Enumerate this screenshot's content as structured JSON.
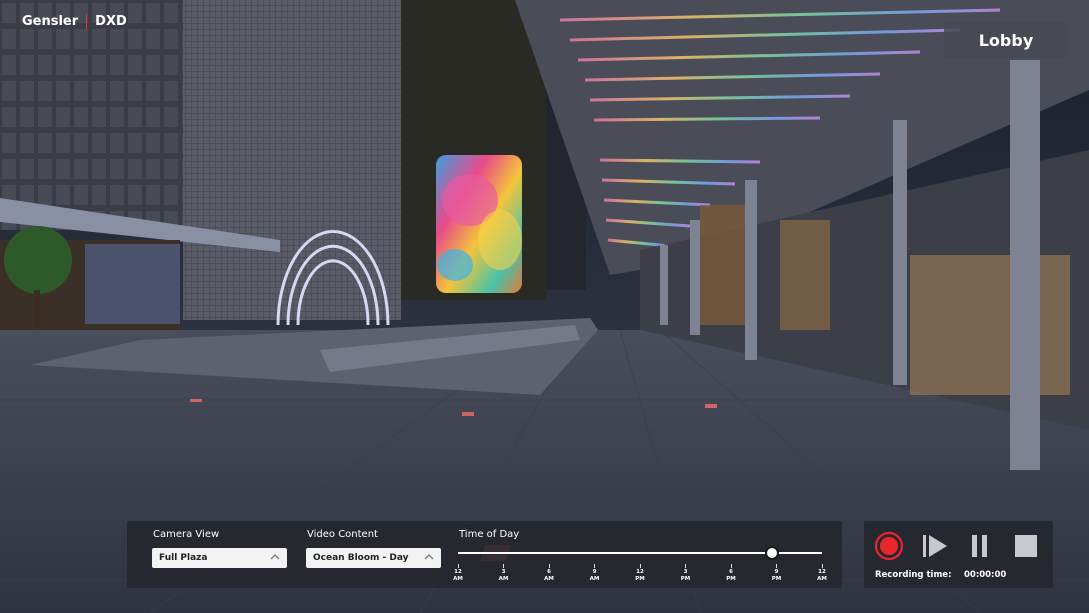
{
  "branding": {
    "company": "Gensler",
    "product": "DXD"
  },
  "location_label": "Lobby",
  "controls": {
    "camera_view": {
      "label": "Camera View",
      "selected": "Full Plaza"
    },
    "video_content": {
      "label": "Video Content",
      "selected": "Ocean Bloom - Day"
    },
    "time_of_day": {
      "label": "Time of Day",
      "ticks": [
        {
          "num": "12",
          "period": "AM"
        },
        {
          "num": "3",
          "period": "AM"
        },
        {
          "num": "6",
          "period": "AM"
        },
        {
          "num": "9",
          "period": "AM"
        },
        {
          "num": "12",
          "period": "PM"
        },
        {
          "num": "3",
          "period": "PM"
        },
        {
          "num": "6",
          "period": "PM"
        },
        {
          "num": "9",
          "period": "PM"
        },
        {
          "num": "12",
          "period": "AM"
        }
      ],
      "value_fraction": 0.86
    }
  },
  "recording": {
    "time_label": "Recording time:",
    "time_value": "00:00:00",
    "record_color": "#e8262b"
  },
  "icons": [
    "record-icon",
    "play-icon",
    "pause-icon",
    "stop-icon",
    "chevron-up-icon"
  ]
}
